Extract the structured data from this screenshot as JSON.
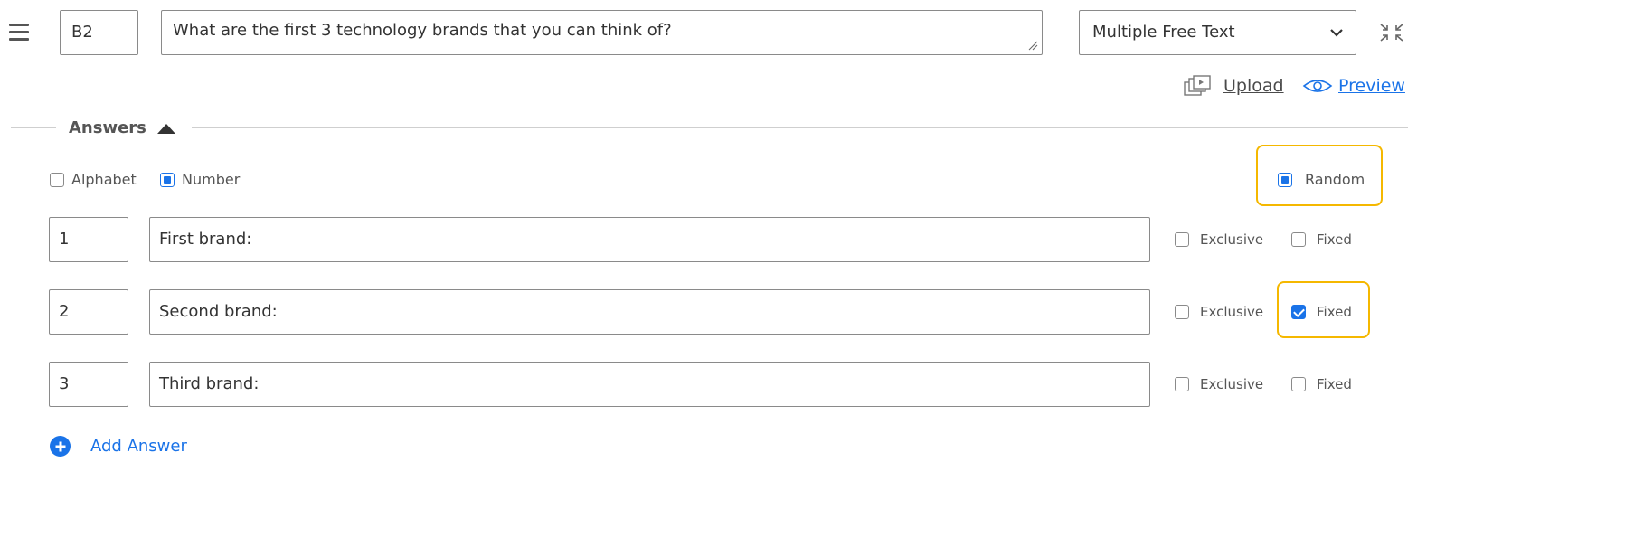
{
  "header": {
    "code": "B2",
    "question": "What are the first 3 technology brands that you can think of?",
    "question_type": "Multiple Free Text"
  },
  "links": {
    "upload": "Upload",
    "preview": "Preview"
  },
  "answers_section": {
    "title": "Answers",
    "options": {
      "alphabet": {
        "label": "Alphabet",
        "checked": false
      },
      "number": {
        "label": "Number",
        "checked": true
      },
      "random": {
        "label": "Random",
        "checked": true
      }
    },
    "rows": [
      {
        "number": "1",
        "text": "First brand:",
        "exclusive_label": "Exclusive",
        "exclusive": false,
        "fixed_label": "Fixed",
        "fixed": false
      },
      {
        "number": "2",
        "text": "Second brand:",
        "exclusive_label": "Exclusive",
        "exclusive": false,
        "fixed_label": "Fixed",
        "fixed": true
      },
      {
        "number": "3",
        "text": "Third brand:",
        "exclusive_label": "Exclusive",
        "exclusive": false,
        "fixed_label": "Fixed",
        "fixed": false
      }
    ],
    "add_answer": "Add Answer"
  },
  "colors": {
    "accent": "#1a73e8",
    "highlight": "#f5b800",
    "border": "#8a8a8a"
  }
}
